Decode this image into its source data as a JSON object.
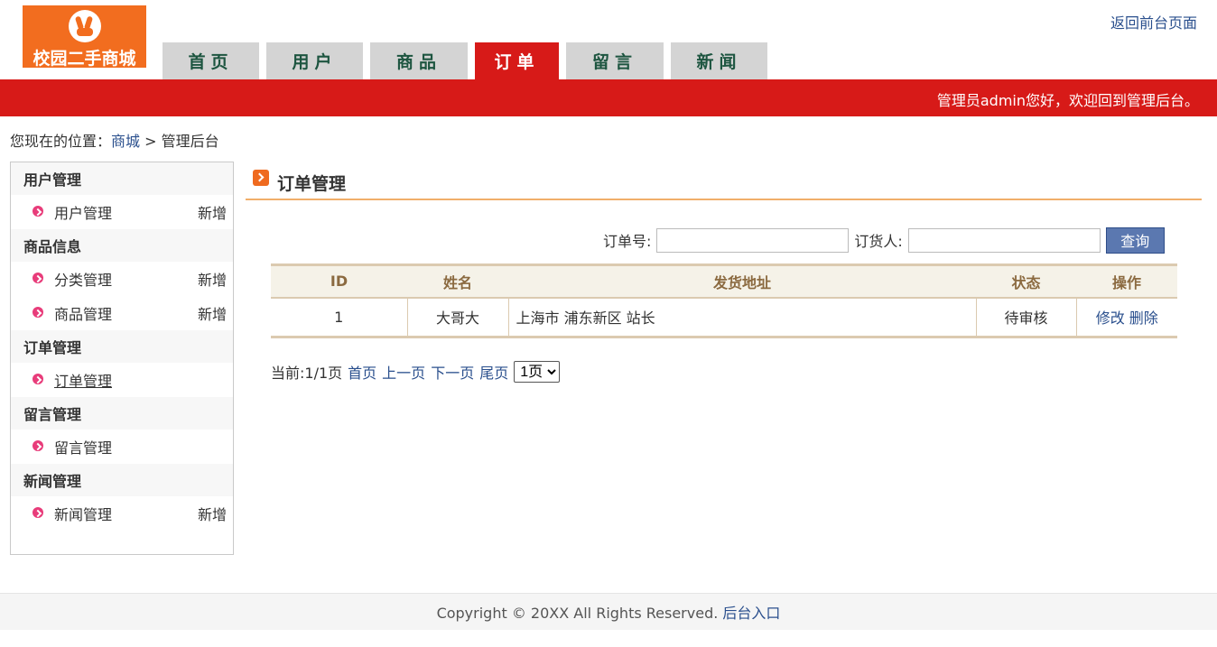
{
  "header": {
    "logo_text": "校园二手商城",
    "back_link": "返回前台页面",
    "welcome": "管理员admin您好，欢迎回到管理后台。"
  },
  "tabs": [
    {
      "label": "首页",
      "active": false
    },
    {
      "label": "用户",
      "active": false
    },
    {
      "label": "商品",
      "active": false
    },
    {
      "label": "订单",
      "active": true
    },
    {
      "label": "留言",
      "active": false
    },
    {
      "label": "新闻",
      "active": false
    }
  ],
  "breadcrumb": {
    "prefix": "您现在的位置：",
    "home": "商城",
    "separator": ">",
    "current": "管理后台"
  },
  "sidebar": {
    "groups": [
      {
        "title": "用户管理",
        "items": [
          {
            "label": "用户管理",
            "add": "新增"
          }
        ]
      },
      {
        "title": "商品信息",
        "items": [
          {
            "label": "分类管理",
            "add": "新增"
          },
          {
            "label": "商品管理",
            "add": "新增"
          }
        ]
      },
      {
        "title": "订单管理",
        "items": [
          {
            "label": "订单管理",
            "add": ""
          }
        ]
      },
      {
        "title": "留言管理",
        "items": [
          {
            "label": "留言管理",
            "add": ""
          }
        ]
      },
      {
        "title": "新闻管理",
        "items": [
          {
            "label": "新闻管理",
            "add": "新增"
          }
        ]
      }
    ]
  },
  "main": {
    "title": "订单管理",
    "search": {
      "order_no_label": "订单号:",
      "order_no_value": "",
      "customer_label": "订货人:",
      "customer_value": "",
      "query_button": "查询"
    },
    "table": {
      "headers": [
        "ID",
        "姓名",
        "发货地址",
        "状态",
        "操作"
      ],
      "rows": [
        {
          "id": "1",
          "name": "大哥大",
          "address": "上海市 浦东新区 站长",
          "status": "待审核",
          "edit": "修改",
          "delete": "删除"
        }
      ]
    },
    "pager": {
      "current": "当前:1/1页",
      "first": "首页",
      "prev": "上一页",
      "next": "下一页",
      "last": "尾页",
      "select_value": "1页"
    }
  },
  "footer": {
    "copyright": "Copyright © 20XX All Rights Reserved.",
    "admin_link": "后台入口"
  },
  "colors": {
    "brand_red": "#d71a18",
    "logo_orange": "#f26d1f",
    "link_blue": "#2a4f8d",
    "button_blue": "#5b78b0"
  }
}
